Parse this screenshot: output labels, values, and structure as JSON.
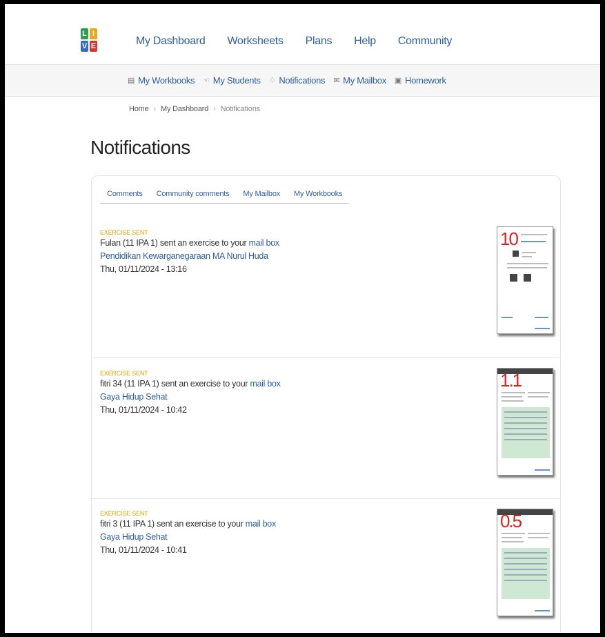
{
  "logo": {
    "letters": [
      "L",
      "I",
      "V",
      "E"
    ],
    "colors": [
      "#2e9e4e",
      "#e8a71c",
      "#2e6fc4",
      "#d9342b"
    ]
  },
  "main_nav": [
    "My Dashboard",
    "Worksheets",
    "Plans",
    "Help",
    "Community"
  ],
  "sub_nav": [
    {
      "icon": "workbook-icon",
      "glyph": "▤",
      "label": "My Workbooks"
    },
    {
      "icon": "students-icon",
      "glyph": "☜",
      "label": "My Students"
    },
    {
      "icon": "bell-icon",
      "glyph": "♢",
      "label": "Notifications"
    },
    {
      "icon": "mail-icon",
      "glyph": "✉",
      "label": "My Mailbox"
    },
    {
      "icon": "homework-icon",
      "glyph": "▣",
      "label": "Homework"
    }
  ],
  "breadcrumb": {
    "home": "Home",
    "dashboard": "My Dashboard",
    "current": "Notifications",
    "separator": "›"
  },
  "page_title": "Notifications",
  "tabs": [
    "Comments",
    "Community comments",
    "My Mailbox",
    "My Workbooks"
  ],
  "notifications": [
    {
      "type": "EXERCISE SENT",
      "sender": "Fulan (11 IPA 1) sent an exercise to your",
      "link": "mail box",
      "workbook": "Pendidikan Kewarganegaraan MA Nurul Huda",
      "date": "Thu, 01/11/2024 - 13:16",
      "score": "10"
    },
    {
      "type": "EXERCISE SENT",
      "sender": "fitri 34 (11 IPA 1) sent an exercise to your",
      "link": "mail box",
      "workbook": "Gaya Hidup Sehat",
      "date": "Thu, 01/11/2024 - 10:42",
      "score": "1.1"
    },
    {
      "type": "EXERCISE SENT",
      "sender": "fitri 3 (11 IPA 1) sent an exercise to your",
      "link": "mail box",
      "workbook": "Gaya Hidup Sehat",
      "date": "Thu, 01/11/2024 - 10:41",
      "score": "0.5"
    }
  ],
  "colors": {
    "link": "#2e5f9e",
    "type_label": "#e0a400",
    "score": "#e02020"
  }
}
